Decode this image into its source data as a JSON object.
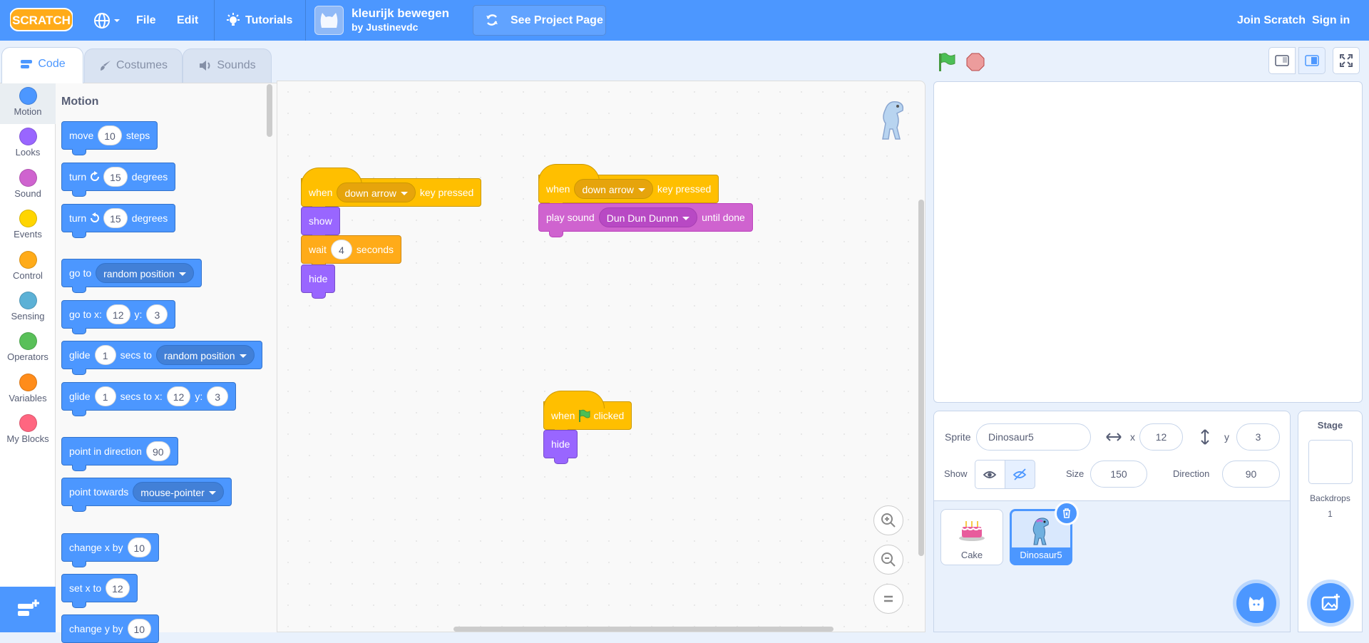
{
  "topbar": {
    "file": "File",
    "edit": "Edit",
    "tutorials": "Tutorials",
    "project_title": "kleurijk bewegen",
    "author": "by Justinevdc",
    "see_project": "See Project Page",
    "join": "Join Scratch",
    "signin": "Sign in"
  },
  "tabs": {
    "code": "Code",
    "costumes": "Costumes",
    "sounds": "Sounds"
  },
  "categories": [
    {
      "label": "Motion",
      "color": "#4c97ff"
    },
    {
      "label": "Looks",
      "color": "#9966ff"
    },
    {
      "label": "Sound",
      "color": "#cf63cf"
    },
    {
      "label": "Events",
      "color": "#ffd500"
    },
    {
      "label": "Control",
      "color": "#ffab19"
    },
    {
      "label": "Sensing",
      "color": "#5cb1d6"
    },
    {
      "label": "Operators",
      "color": "#59c059"
    },
    {
      "label": "Variables",
      "color": "#ff8c1a"
    },
    {
      "label": "My Blocks",
      "color": "#ff6680"
    }
  ],
  "palette": {
    "heading": "Motion",
    "move": {
      "a": "move",
      "n": "10",
      "b": "steps"
    },
    "turn_r": {
      "a": "turn",
      "n": "15",
      "b": "degrees"
    },
    "turn_l": {
      "a": "turn",
      "n": "15",
      "b": "degrees"
    },
    "goto": {
      "a": "go to",
      "d": "random position"
    },
    "gotoxy": {
      "a": "go to x:",
      "x": "12",
      "b": "y:",
      "y": "3"
    },
    "glide1": {
      "a": "glide",
      "n": "1",
      "b": "secs to",
      "d": "random position"
    },
    "glide2": {
      "a": "glide",
      "n": "1",
      "b": "secs to x:",
      "x": "12",
      "c": "y:",
      "y": "3"
    },
    "point_dir": {
      "a": "point in direction",
      "n": "90"
    },
    "point_towards": {
      "a": "point towards",
      "d": "mouse-pointer"
    },
    "change_x": {
      "a": "change x by",
      "n": "10"
    },
    "set_x": {
      "a": "set x to",
      "n": "12"
    },
    "change_y": {
      "a": "change y by",
      "n": "10"
    }
  },
  "scripts": {
    "s1": {
      "when": "when",
      "key": "down arrow",
      "pressed": "key pressed",
      "show": "show",
      "wait": "wait",
      "secs": "4",
      "seconds": "seconds",
      "hide": "hide"
    },
    "s2": {
      "when": "when",
      "key": "down arrow",
      "pressed": "key pressed",
      "play": "play sound",
      "sound": "Dun Dun Dunnn",
      "until": "until done"
    },
    "s3": {
      "when": "when",
      "clicked": "clicked",
      "hide": "hide"
    }
  },
  "sprite_info": {
    "sprite_label": "Sprite",
    "sprite_name": "Dinosaur5",
    "x_label": "x",
    "x": "12",
    "y_label": "y",
    "y": "3",
    "show_label": "Show",
    "size_label": "Size",
    "size": "150",
    "direction_label": "Direction",
    "direction": "90"
  },
  "sprites": [
    {
      "name": "Cake"
    },
    {
      "name": "Dinosaur5"
    }
  ],
  "stage_panel": {
    "title": "Stage",
    "backdrops_label": "Backdrops",
    "backdrops_count": "1"
  }
}
